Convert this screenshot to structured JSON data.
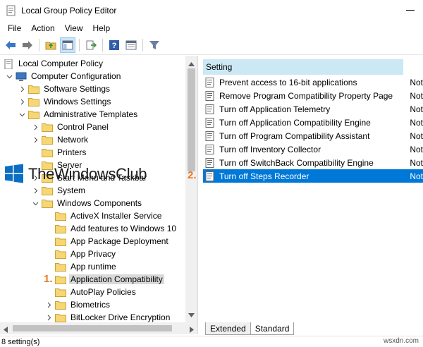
{
  "window": {
    "title": "Local Group Policy Editor"
  },
  "menu": [
    "File",
    "Action",
    "View",
    "Help"
  ],
  "tree": {
    "items": [
      {
        "label": "Local Computer Policy",
        "level": 0
      },
      {
        "label": "Computer Configuration",
        "level": 1
      },
      {
        "label": "Software Settings",
        "level": 2
      },
      {
        "label": "Windows Settings",
        "level": 2
      },
      {
        "label": "Administrative Templates",
        "level": 2
      },
      {
        "label": "Control Panel",
        "level": 3
      },
      {
        "label": "Network",
        "level": 3
      },
      {
        "label": "Printers",
        "level": 3
      },
      {
        "label": "Server",
        "level": 3
      },
      {
        "label": "Start Menu and Taskbar",
        "level": 3
      },
      {
        "label": "System",
        "level": 3
      },
      {
        "label": "Windows Components",
        "level": 3
      },
      {
        "label": "ActiveX Installer Service",
        "level": 4
      },
      {
        "label": "Add features to Windows 10",
        "level": 4
      },
      {
        "label": "App Package Deployment",
        "level": 4
      },
      {
        "label": "App Privacy",
        "level": 4
      },
      {
        "label": "App runtime",
        "level": 4
      },
      {
        "label": "Application Compatibility",
        "level": 4
      },
      {
        "label": "AutoPlay Policies",
        "level": 4
      },
      {
        "label": "Biometrics",
        "level": 4
      },
      {
        "label": "BitLocker Drive Encryption",
        "level": 4
      }
    ]
  },
  "settings": {
    "column_header": "Setting",
    "rows": [
      {
        "name": "Prevent access to 16-bit applications",
        "state": "Not"
      },
      {
        "name": "Remove Program Compatibility Property Page",
        "state": "Not"
      },
      {
        "name": "Turn off Application Telemetry",
        "state": "Not"
      },
      {
        "name": "Turn off Application Compatibility Engine",
        "state": "Not"
      },
      {
        "name": "Turn off Program Compatibility Assistant",
        "state": "Not"
      },
      {
        "name": "Turn off Inventory Collector",
        "state": "Not"
      },
      {
        "name": "Turn off SwitchBack Compatibility Engine",
        "state": "Not"
      },
      {
        "name": "Turn off Steps Recorder",
        "state": "Not"
      }
    ]
  },
  "tabs": [
    "Extended",
    "Standard"
  ],
  "status": "8 setting(s)",
  "callouts": [
    "1.",
    "2."
  ],
  "watermark": {
    "brand": "TheWindowsClub",
    "site": "wsxdn.com"
  },
  "colors": {
    "selection": "#0078d7",
    "header": "#cce8f4",
    "callout": "#e87722",
    "tree_selection": "#d9d9d9"
  }
}
